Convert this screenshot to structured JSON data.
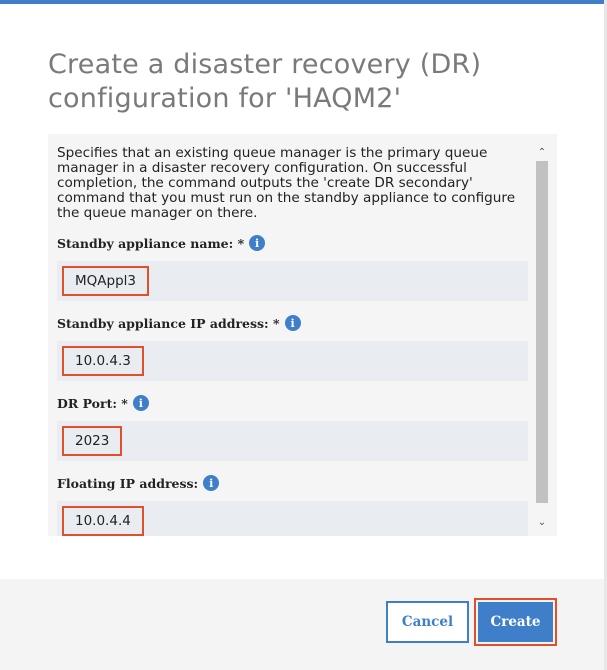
{
  "dialog": {
    "title": "Create a disaster recovery (DR) configuration for 'HAQM2'",
    "description": "Specifies that an existing queue manager is the primary queue manager in a disaster recovery configuration. On successful completion, the command outputs the 'create DR secondary' command that you must run on the standby appliance to configure the queue manager on there."
  },
  "fields": [
    {
      "label": "Standby appliance name: *",
      "value": "MQAppl3"
    },
    {
      "label": "Standby appliance IP address: *",
      "value": "10.0.4.3"
    },
    {
      "label": "DR Port: *",
      "value": "2023"
    },
    {
      "label": "Floating IP address:",
      "value": "10.0.4.4"
    }
  ],
  "icons": {
    "info": "i",
    "scroll_up": "⌃",
    "scroll_down": "⌄"
  },
  "footer": {
    "cancel_label": "Cancel",
    "create_label": "Create"
  },
  "colors": {
    "accent": "#3f7ec9",
    "highlight": "#e0502b"
  }
}
